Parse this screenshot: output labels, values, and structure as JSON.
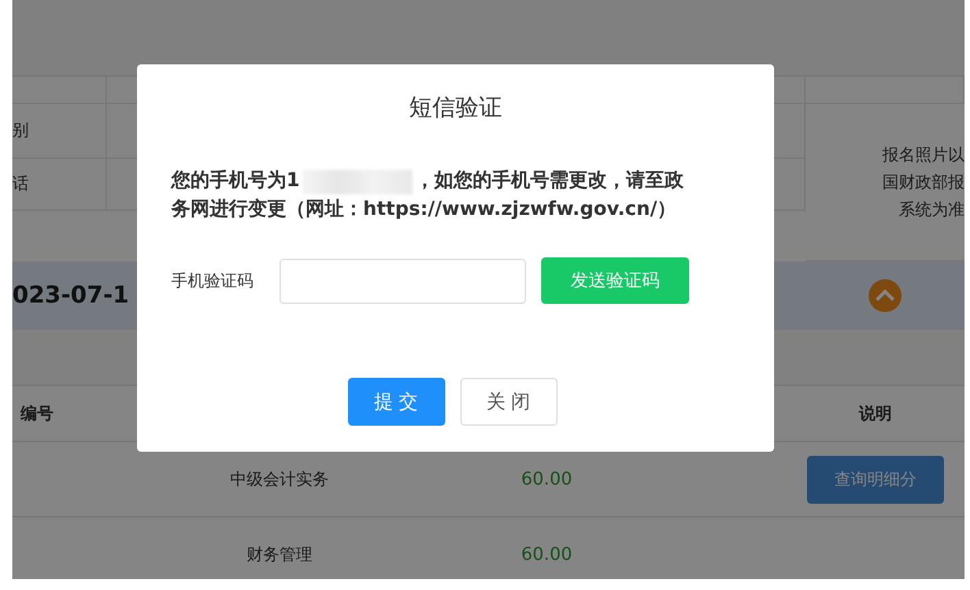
{
  "background": {
    "upper_table": {
      "row_labels": [
        "别",
        "话"
      ],
      "photo_note": [
        "报名照片以",
        "国财政部报",
        "系统为准"
      ]
    },
    "date_bar": {
      "date": "023-07-1"
    },
    "scores_table": {
      "header_left": "编号",
      "header_right": "说明",
      "rows": [
        {
          "subject": "中级会计实务",
          "score": "60.00",
          "button": "查询明细分"
        },
        {
          "subject": "财务管理",
          "score": "60.00"
        }
      ]
    }
  },
  "dialog": {
    "title": "短信验证",
    "message_start": "您的手机号为1",
    "message_line1_end": "，如您的手机号需更改，请至政",
    "message_line2": "务网进行变更（网址：https://www.zjzwfw.gov.cn/）",
    "code_label": "手机验证码",
    "send_button": "发送验证码",
    "buttons": [
      {
        "label": "提 交",
        "kind": "primary"
      },
      {
        "label": "关 闭",
        "kind": "default"
      }
    ]
  }
}
